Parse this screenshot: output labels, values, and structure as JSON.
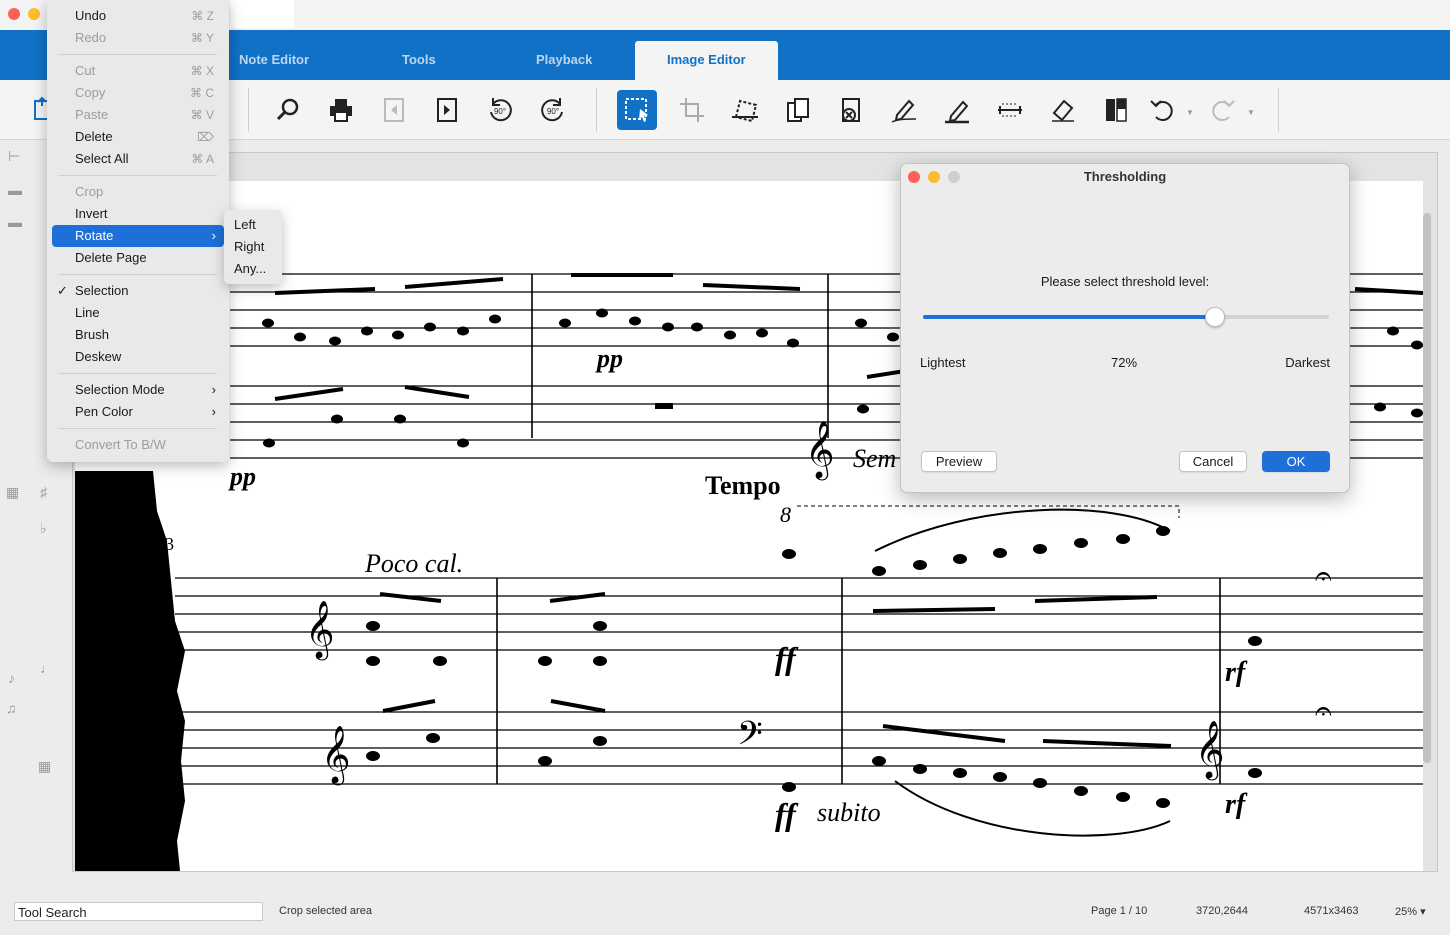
{
  "tabs": [
    {
      "label": "Note Editor",
      "active": false
    },
    {
      "label": "Tools",
      "active": false
    },
    {
      "label": "Playback",
      "active": false
    },
    {
      "label": "Image Editor",
      "active": true
    }
  ],
  "toolbar": {
    "rotate_left_label": "90°",
    "rotate_right_label": "90°"
  },
  "edit_menu": {
    "undo": {
      "label": "Undo",
      "shortcut": "⌘ Z"
    },
    "redo": {
      "label": "Redo",
      "shortcut": "⌘ Y"
    },
    "cut": {
      "label": "Cut",
      "shortcut": "⌘ X"
    },
    "copy": {
      "label": "Copy",
      "shortcut": "⌘ C"
    },
    "paste": {
      "label": "Paste",
      "shortcut": "⌘ V"
    },
    "delete": {
      "label": "Delete",
      "shortcut": "⌦"
    },
    "select_all": {
      "label": "Select All",
      "shortcut": "⌘ A"
    },
    "crop": {
      "label": "Crop"
    },
    "invert": {
      "label": "Invert"
    },
    "rotate": {
      "label": "Rotate"
    },
    "delete_page": {
      "label": "Delete Page"
    },
    "selection": {
      "label": "Selection",
      "checked": true
    },
    "line": {
      "label": "Line"
    },
    "brush": {
      "label": "Brush"
    },
    "deskew": {
      "label": "Deskew"
    },
    "selection_mode": {
      "label": "Selection Mode"
    },
    "pen_color": {
      "label": "Pen Color"
    },
    "convert_bw": {
      "label": "Convert To B/W"
    }
  },
  "rotate_submenu": [
    "Left",
    "Right",
    "Any..."
  ],
  "score": {
    "dynamics": {
      "pp1": "pp",
      "pp2": "pp",
      "ff1": "ff",
      "ff2": "ff",
      "rf1": "rf",
      "rf2": "rf"
    },
    "tempo": "Tempo",
    "octave": "8",
    "poco": "Poco cal.",
    "subito": "subito",
    "sem": "Sem",
    "measure_number": "3"
  },
  "dialog": {
    "title": "Thresholding",
    "prompt": "Please select threshold level:",
    "value_percent": 72,
    "value_label": "72%",
    "min_label": "Lightest",
    "max_label": "Darkest",
    "preview_label": "Preview",
    "cancel_label": "Cancel",
    "ok_label": "OK"
  },
  "status": {
    "tool_search": "Tool Search",
    "hint": "Crop selected area",
    "page": "Page 1 / 10",
    "coords": "3720,2644",
    "image_size": "4571x3463",
    "zoom": "25%"
  },
  "colors": {
    "accent": "#1071c6",
    "highlight": "#1e6fd8"
  }
}
